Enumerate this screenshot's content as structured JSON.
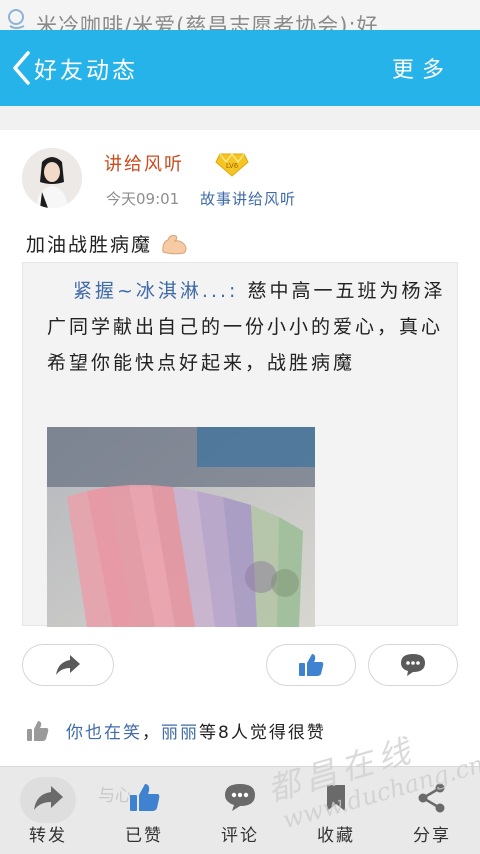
{
  "status": {
    "notification_text": "米冷咖啡/米爱(慈昌志愿者协会):好. . ."
  },
  "header": {
    "title": "好友动态",
    "more_label": "更多",
    "bg_color": "#26b3ea"
  },
  "post": {
    "author": "讲给风听",
    "badge_icon": "vip-crown-icon",
    "time": "今天09:01",
    "source": "故事讲给风听",
    "text": "加油战胜病魔",
    "emoji_icon": "flexed-biceps-emoji",
    "quoted": {
      "author": "紧握~冰淇淋...:",
      "text": "慈中高一五班为杨泽广同学献出自己的一份小小的爱心，真心希望你能快点好起来，战胜病魔"
    }
  },
  "actions": {
    "share_icon": "share-arrow-icon",
    "like_icon": "thumbs-up-icon",
    "comment_icon": "comment-bubble-icon"
  },
  "likes": {
    "name1": "你也在笑",
    "sep": "，",
    "name2": "丽丽",
    "rest": "等8人觉得很赞"
  },
  "bottom": {
    "ghost_text": "与心",
    "tabs": [
      {
        "label": "转发",
        "icon": "forward-icon"
      },
      {
        "label": "已赞",
        "icon": "thumbs-up-icon"
      },
      {
        "label": "评论",
        "icon": "comment-icon"
      },
      {
        "label": "收藏",
        "icon": "bookmark-icon"
      },
      {
        "label": "分享",
        "icon": "share-icon"
      }
    ]
  },
  "watermark": {
    "line1": "都昌在线",
    "line2": "www.duchang.cn"
  }
}
